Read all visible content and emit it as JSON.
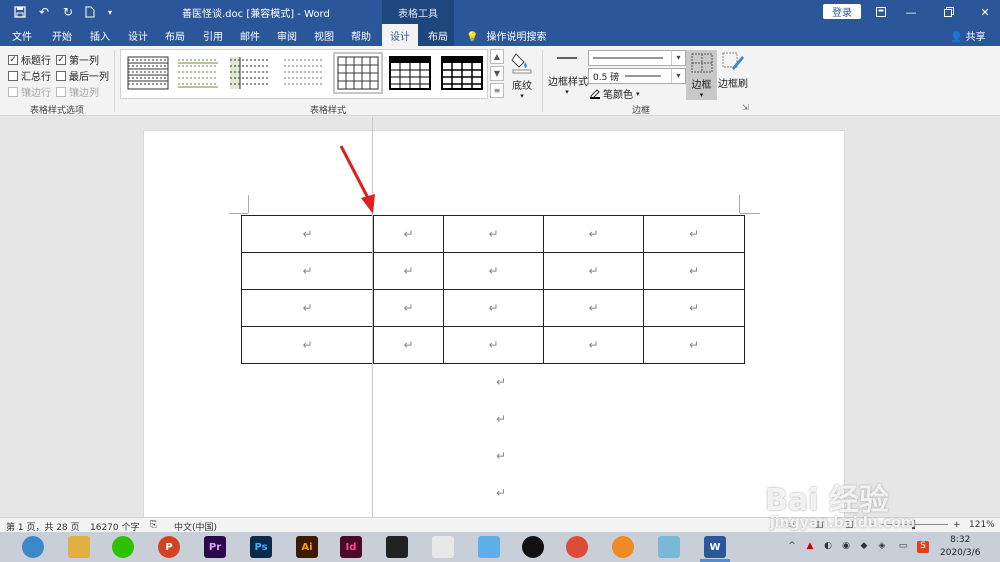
{
  "titlebar": {
    "doc_title": "善医怪谈.doc [兼容模式]  -  Word",
    "context_tools": "表格工具",
    "login": "登录",
    "quick_access": [
      "save-icon",
      "undo-icon",
      "redo-icon",
      "new-doc-icon",
      "customize-icon"
    ],
    "window": [
      "ribbon-display-icon",
      "minimize-icon",
      "restore-icon",
      "close-icon"
    ]
  },
  "tabs": [
    "文件",
    "开始",
    "插入",
    "设计",
    "布局",
    "引用",
    "邮件",
    "审阅",
    "视图",
    "帮助",
    "设计",
    "布局"
  ],
  "tell_me": "操作说明搜索",
  "share": "共享",
  "ribbon": {
    "style_options": {
      "label": "表格样式选项",
      "header_row": "标题行",
      "first_column": "第一列",
      "total_row": "汇总行",
      "last_column": "最后一列",
      "banded_rows": "镶边行",
      "banded_columns": "镶边列"
    },
    "table_styles": {
      "label": "表格样式"
    },
    "shading": "底纹",
    "borders": {
      "label": "边框",
      "border_styles": "边框样式",
      "width": "0.5 磅",
      "pen_color": "笔颜色",
      "borders_btn": "边框",
      "border_painter": "边框刷"
    }
  },
  "document": {
    "enter_mark": "↵",
    "table": {
      "rows": 4,
      "cols": 5
    }
  },
  "status": {
    "page": "第 1 页，共 28 页",
    "words": "16270 个字",
    "language": "中文(中国)",
    "zoom": "121%",
    "zoom_minus": "−",
    "zoom_plus": "+"
  },
  "taskbar": {
    "apps": [
      {
        "name": "browser",
        "label": "",
        "color": "#3b88c9"
      },
      {
        "name": "explorer",
        "label": "",
        "color": "#e0b040"
      },
      {
        "name": "wechat",
        "label": "",
        "color": "#2dc100"
      },
      {
        "name": "powerpoint",
        "label": "P",
        "color": "#d04423"
      },
      {
        "name": "premiere",
        "label": "Pr",
        "color": "#2a0a4a"
      },
      {
        "name": "photoshop",
        "label": "Ps",
        "color": "#0b2a4a"
      },
      {
        "name": "illustrator",
        "label": "Ai",
        "color": "#3a1a00"
      },
      {
        "name": "indesign",
        "label": "Id",
        "color": "#4a0a2a"
      },
      {
        "name": "video-editor",
        "label": "",
        "color": "#222222"
      },
      {
        "name": "picasa",
        "label": "",
        "color": "#e8e8e8"
      },
      {
        "name": "bird-app",
        "label": "",
        "color": "#5fb0e8"
      },
      {
        "name": "qq",
        "label": "",
        "color": "#111111"
      },
      {
        "name": "chrome",
        "label": "",
        "color": "#dd4b39"
      },
      {
        "name": "orange-app",
        "label": "",
        "color": "#f08a24"
      },
      {
        "name": "files-app",
        "label": "",
        "color": "#7ab8d8"
      },
      {
        "name": "word",
        "label": "W",
        "color": "#2b579a"
      }
    ],
    "time": "8:32",
    "date": "2020/3/6"
  },
  "watermark": {
    "main": "Bai 经验",
    "sub": "jingyan.baidu.com"
  },
  "colors": {
    "accent": "#2b579a",
    "arrow": "#e02020"
  }
}
